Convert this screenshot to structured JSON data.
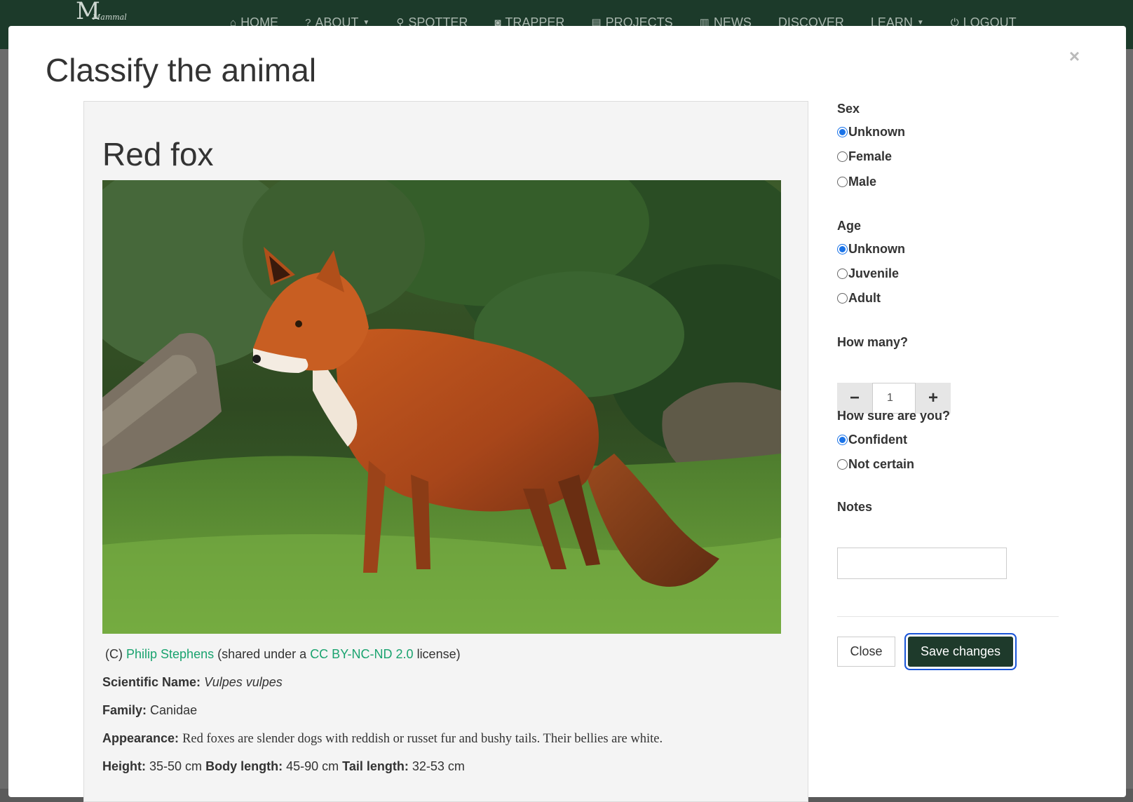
{
  "nav": {
    "brand": "Mammal",
    "brand_mark": "M",
    "items": [
      {
        "icon": "home-icon",
        "glyph": "⌂",
        "label": "HOME"
      },
      {
        "icon": "question-icon",
        "glyph": "?",
        "label": "ABOUT",
        "caret": true
      },
      {
        "icon": "search-icon",
        "glyph": "⚲",
        "label": "SPOTTER"
      },
      {
        "icon": "camera-icon",
        "glyph": "◙",
        "label": "TRAPPER"
      },
      {
        "icon": "book-icon",
        "glyph": "▤",
        "label": "PROJECTS"
      },
      {
        "icon": "newspaper-icon",
        "glyph": "▥",
        "label": "NEWS"
      },
      {
        "icon": "",
        "glyph": "",
        "label": "DISCOVER"
      },
      {
        "icon": "",
        "glyph": "",
        "label": "LEARN",
        "caret": true
      },
      {
        "icon": "power-icon",
        "glyph": "⏻",
        "label": "LOGOUT"
      }
    ]
  },
  "modal": {
    "title": "Classify the animal",
    "close_glyph": "×"
  },
  "species": {
    "name": "Red fox",
    "credit": {
      "prefix": "(C) ",
      "author": "Philip Stephens",
      "middle": " (shared under a ",
      "license": "CC BY-NC-ND 2.0",
      "suffix": " license)"
    },
    "scientific_label": "Scientific Name:",
    "scientific_name": "Vulpes vulpes",
    "family_label": "Family:",
    "family": "Canidae",
    "appearance_label": "Appearance:",
    "appearance": "Red foxes are slender dogs with reddish or russet fur and bushy tails. Their bellies are white.",
    "height_label": "Height:",
    "height": "35-50 cm",
    "body_length_label": "Body length:",
    "body_length": "45-90 cm",
    "tail_length_label": "Tail length:",
    "tail_length": "32-53 cm"
  },
  "form": {
    "sex_label": "Sex",
    "sex_options": [
      "Unknown",
      "Female",
      "Male"
    ],
    "sex_selected": "Unknown",
    "age_label": "Age",
    "age_options": [
      "Unknown",
      "Juvenile",
      "Adult"
    ],
    "age_selected": "Unknown",
    "count_label": "How many?",
    "count_value": "1",
    "minus_glyph": "−",
    "plus_glyph": "+",
    "certainty_label": "How sure are you?",
    "certainty_options": [
      "Confident",
      "Not certain"
    ],
    "certainty_selected": "Confident",
    "notes_label": "Notes",
    "notes_value": "",
    "close_button": "Close",
    "save_button": "Save changes"
  },
  "colors": {
    "nav_bg": "#1c3a2a",
    "link": "#1aa36f",
    "primary_button": "#1e3a2b",
    "radio_checked": "#1a73e8"
  }
}
